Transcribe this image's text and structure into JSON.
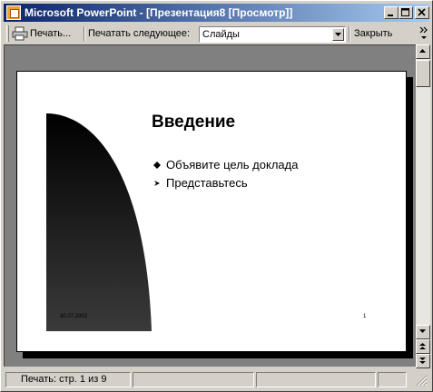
{
  "window": {
    "title": "Microsoft PowerPoint - [Презентация8 [Просмотр]]"
  },
  "toolbar": {
    "print_label": "Печать...",
    "print_what_label": "Печатать следующее:",
    "print_what_value": "Слайды",
    "close_label": "Закрыть"
  },
  "slide": {
    "title": "Введение",
    "bullets": [
      "Объявите цель доклада",
      "Представьтесь"
    ],
    "date": "30.07.2002",
    "number": "1"
  },
  "status": {
    "page_text": "Печать: стр. 1 из 9"
  },
  "colors": {
    "titlebar_start": "#0a246a",
    "titlebar_end": "#a6caf0",
    "chrome": "#d4d0c8",
    "preview_bg": "#808080"
  }
}
